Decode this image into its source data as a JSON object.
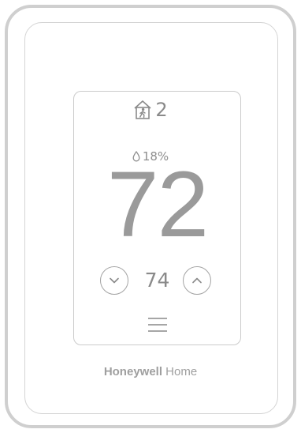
{
  "device": {
    "occupancy": {
      "icon": "home-person-icon",
      "count": "2"
    },
    "humidity": {
      "icon": "water-drop-icon",
      "value": "18%"
    },
    "temperature": "72",
    "setpoint": {
      "value": "74",
      "decrease_icon": "chevron-down-icon",
      "increase_icon": "chevron-up-icon"
    },
    "menu_icon": "hamburger-menu-icon",
    "brand": {
      "name": "Honeywell",
      "sub": "Home"
    }
  },
  "colors": {
    "frame": "#cfcfcf",
    "text": "#8c8c8c",
    "temperature": "#9a9a9a"
  }
}
